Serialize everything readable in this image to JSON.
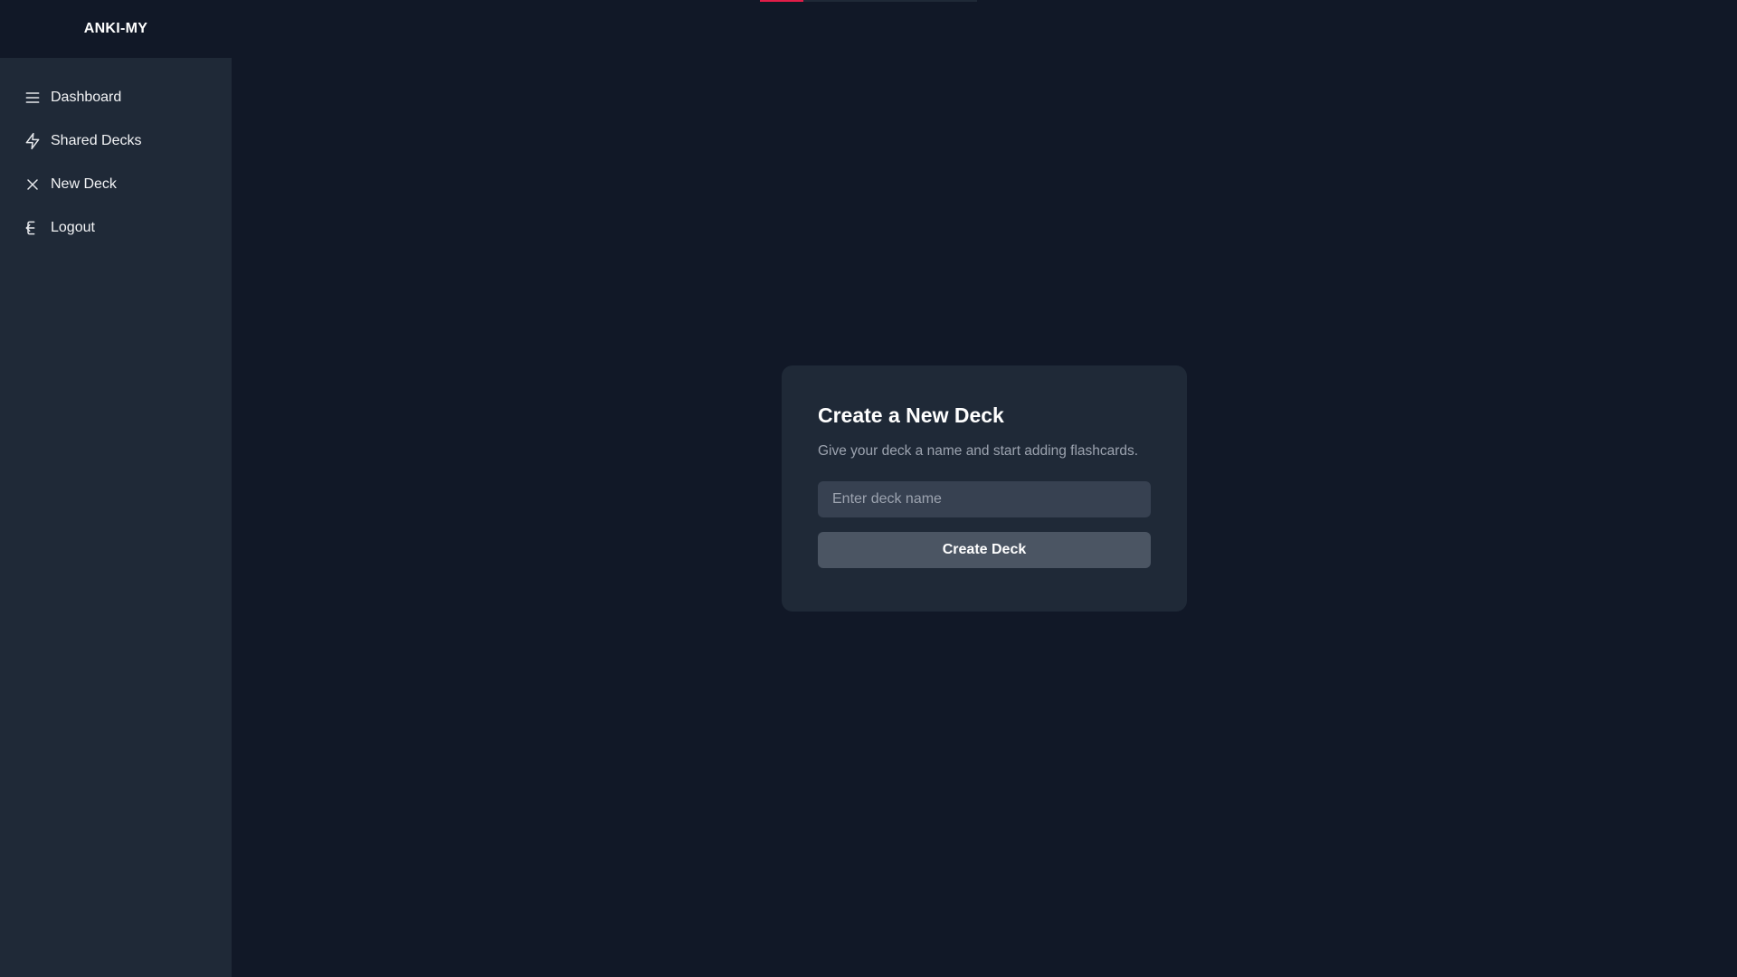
{
  "app": {
    "brand": "ANKI-MY"
  },
  "sidebar": {
    "items": [
      {
        "label": "Dashboard",
        "icon": "menu-icon"
      },
      {
        "label": "Shared Decks",
        "icon": "lightning-icon"
      },
      {
        "label": "New Deck",
        "icon": "close-icon"
      },
      {
        "label": "Logout",
        "icon": "logout-icon"
      }
    ]
  },
  "loading_bar": {
    "progress": 0.2,
    "color": "#e11d48"
  },
  "card": {
    "title": "Create a New Deck",
    "subtitle": "Give your deck a name and start adding flashcards.",
    "input": {
      "value": "",
      "placeholder": "Enter deck name"
    },
    "button_label": "Create Deck"
  },
  "colors": {
    "background": "#111827",
    "sidebar": "#1f2937",
    "card": "#1f2937",
    "input": "#374151",
    "button": "#4b5563"
  }
}
